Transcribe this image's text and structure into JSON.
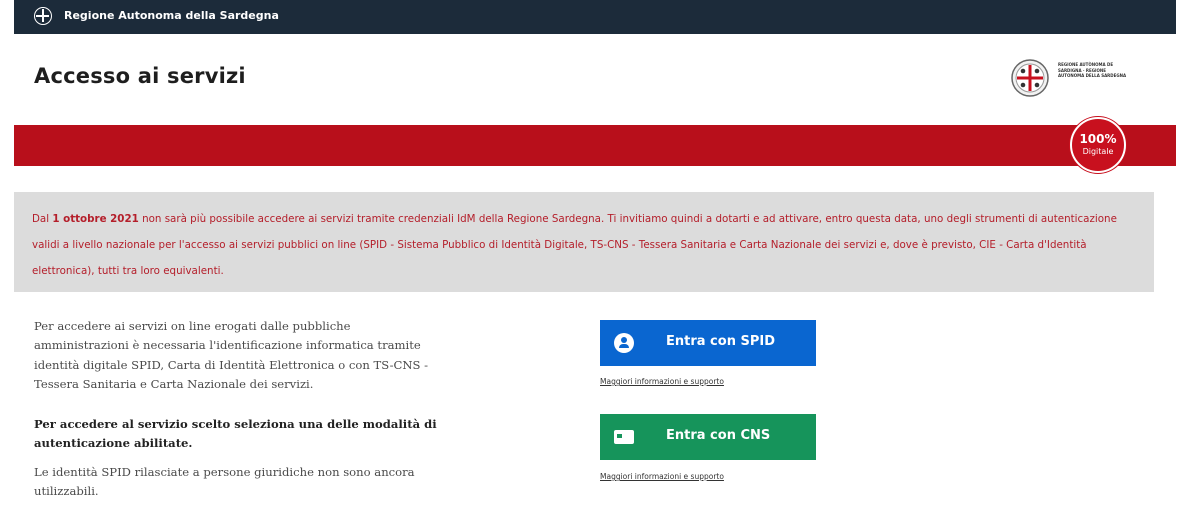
{
  "topbar": {
    "brand": "Regione Autonoma della Sardegna"
  },
  "header": {
    "title": "Accesso ai servizi",
    "logo_text": "REGIONE AUTÒNOMA DE SARDIGNA · REGIONE AUTONOMA DELLA SARDEGNA"
  },
  "badge": {
    "percent": "100%",
    "label": "Digitale"
  },
  "notice": {
    "prefix": "Dal ",
    "date": "1 ottobre 2021",
    "text": " non sarà più possibile accedere ai servizi tramite credenziali IdM della Regione Sardegna. Ti invitiamo quindi a dotarti e ad attivare, entro questa data, uno degli strumenti di autenticazione validi a livello nazionale per l'accesso ai servizi pubblici on line (SPID - Sistema Pubblico di Identità Digitale, TS-CNS - Tessera Sanitaria e Carta Nazionale dei servizi e, dove è previsto, CIE - Carta d'Identità elettronica), tutti tra loro equivalenti."
  },
  "intro": {
    "paragraph": "Per accedere ai servizi on line erogati dalle pubbliche amministrazioni è necessaria l'identificazione informatica tramite identità digitale SPID, Carta di Identità Elettronica o con TS-CNS - Tessera Sanitaria e Carta Nazionale dei servizi.",
    "select_instruction": "Per accedere al servizio scelto seleziona una delle modalità di autenticazione abilitate.",
    "spid_note": "Le identità SPID rilasciate a persone giuridiche non sono ancora utilizzabili."
  },
  "auth": {
    "spid_label": "Entra con SPID",
    "cns_label": "Entra con CNS",
    "help_link": "Maggiori informazioni e supporto"
  },
  "colors": {
    "topbar": "#1c2b3a",
    "red_band": "#b80f1b",
    "spid_button": "#0a66d0",
    "cns_button": "#16945b",
    "notice_text": "#b41e2a"
  },
  "icons": {
    "topbar_logo": "region-crest-icon",
    "spid": "user-icon",
    "cns": "card-icon"
  }
}
